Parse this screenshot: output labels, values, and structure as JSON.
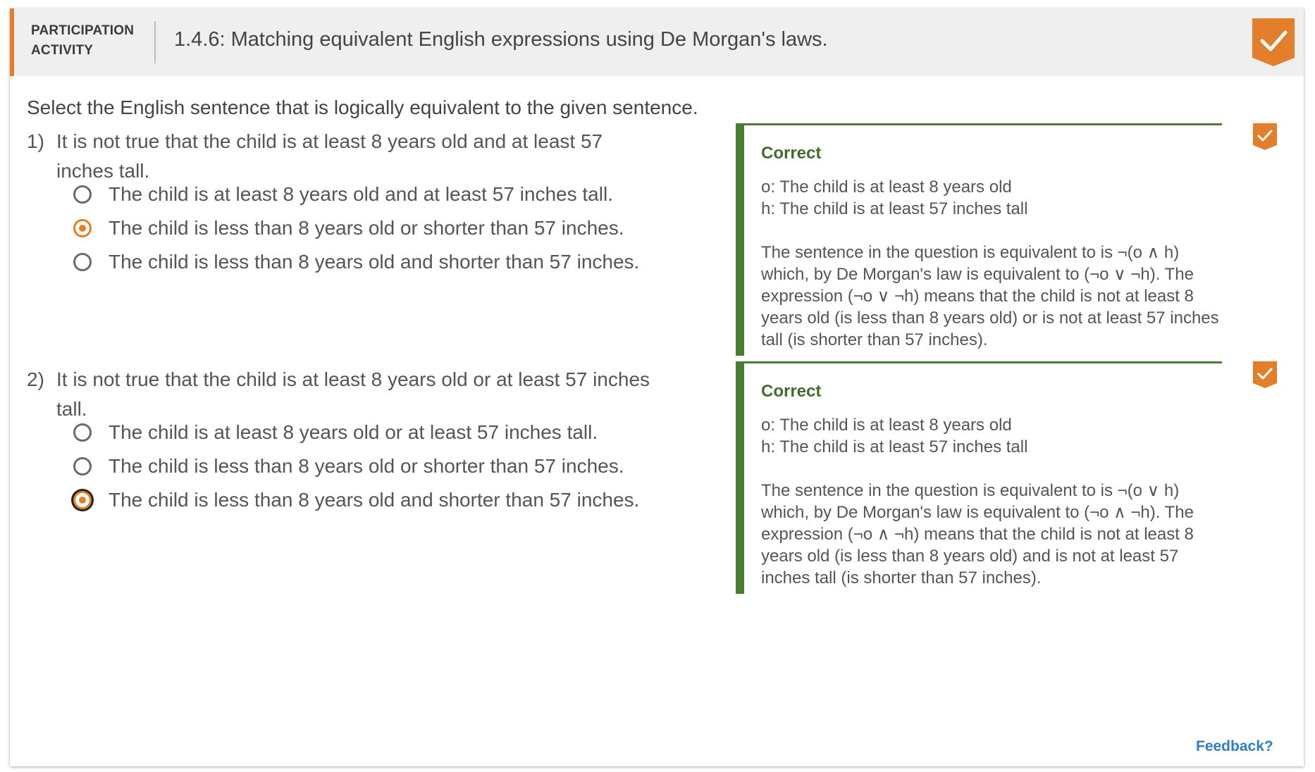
{
  "header": {
    "activity_label_1": "PARTICIPATION",
    "activity_label_2": "ACTIVITY",
    "title": "1.4.6: Matching equivalent English expressions using De Morgan's laws."
  },
  "instruction": "Select the English sentence that is logically equivalent to the given sentence.",
  "questions": [
    {
      "number": "1)",
      "text_line1": "It is not true that the child is at least 8 years old and at least 57",
      "text_line2": "inches tall.",
      "options": [
        {
          "label": "The child is at least 8 years old and at least 57 inches tall.",
          "selected": false
        },
        {
          "label": "The child is less than 8 years old or shorter than 57 inches.",
          "selected": true
        },
        {
          "label": "The child is less than 8 years old and shorter than 57 inches.",
          "selected": false
        }
      ],
      "feedback": {
        "status": "Correct",
        "def_o": "o: The child is at least 8 years old",
        "def_h": "h: The child is at least 57 inches tall",
        "explanation": "The sentence in the question is equivalent to is ¬(o ∧ h) which, by De Morgan's law is equivalent to (¬o ∨ ¬h). The expression (¬o ∨ ¬h) means that the child is not at least 8 years old (is less than 8 years old) or is not at least 57 inches tall (is shorter than 57 inches)."
      }
    },
    {
      "number": "2)",
      "text_line1": "It is not true that the child is at least 8 years old or at least 57 inches",
      "text_line2": "tall.",
      "options": [
        {
          "label": "The child is at least 8 years old or at least 57 inches tall.",
          "selected": false
        },
        {
          "label": "The child is less than 8 years old or shorter than 57 inches.",
          "selected": false
        },
        {
          "label": "The child is less than 8 years old and shorter than 57 inches.",
          "selected": true
        }
      ],
      "feedback": {
        "status": "Correct",
        "def_o": "o: The child is at least 8 years old",
        "def_h": "h: The child is at least 57 inches tall",
        "explanation": "The sentence in the question is equivalent to is ¬(o ∨ h) which, by De Morgan's law is equivalent to (¬o ∧ ¬h). The expression (¬o ∧ ¬h) means that the child is not at least 8 years old (is less than 8 years old) and is not at least 57 inches tall (is shorter than 57 inches)."
      }
    }
  ],
  "feedback_link": "Feedback?",
  "colors": {
    "accent": "#e37e2a",
    "correct_green": "#4a7d34",
    "link": "#2f7fbf"
  },
  "icons": {
    "completion": "checkmark-ribbon-icon",
    "question_complete": "checkmark-ribbon-icon"
  }
}
